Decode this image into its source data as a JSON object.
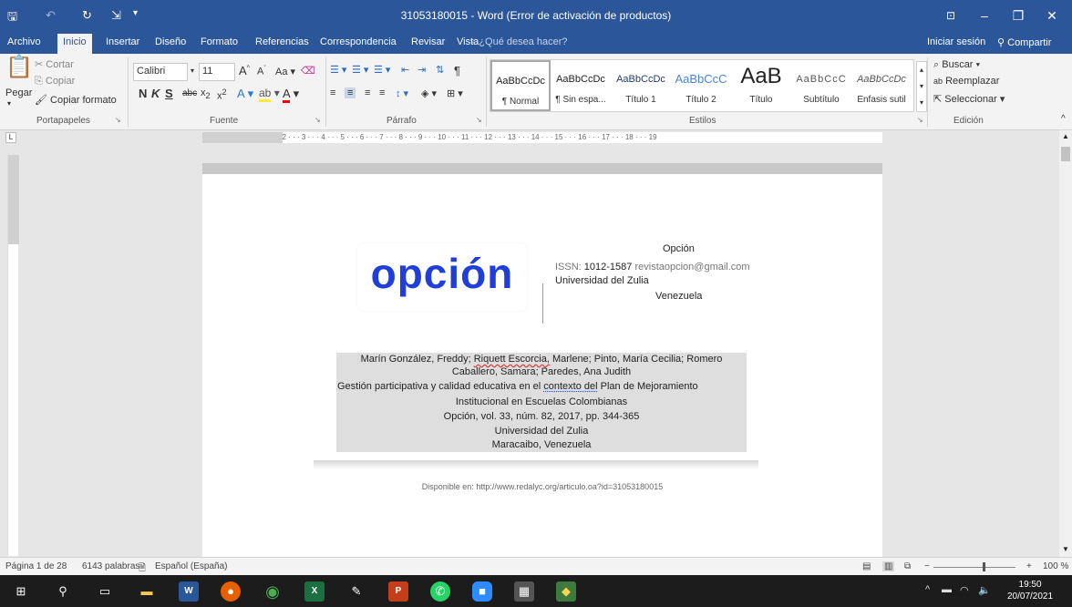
{
  "window": {
    "title": "31053180015 - Word (Error de activación de productos)"
  },
  "tabs": [
    "Archivo",
    "Inicio",
    "Insertar",
    "Diseño",
    "Formato",
    "Referencias",
    "Correspondencia",
    "Revisar",
    "Vista"
  ],
  "tell_me": "¿Qué desea hacer?",
  "account": {
    "signin": "Iniciar sesión",
    "share": "Compartir"
  },
  "ribbon": {
    "clipboard": {
      "paste": "Pegar",
      "cut": "Cortar",
      "copy": "Copiar",
      "format_painter": "Copiar formato",
      "label": "Portapapeles"
    },
    "font": {
      "name": "Calibri",
      "size": "11",
      "label": "Fuente"
    },
    "paragraph": {
      "label": "Párrafo"
    },
    "styles": {
      "label": "Estilos",
      "items": [
        {
          "sample": "AaBbCcDc",
          "name": "¶ Normal"
        },
        {
          "sample": "AaBbCcDc",
          "name": "¶ Sin espa..."
        },
        {
          "sample": "AaBbCcDc",
          "name": "Título 1"
        },
        {
          "sample": "AaBbCcC",
          "name": "Título 2"
        },
        {
          "sample": "AaB",
          "name": "Título"
        },
        {
          "sample": "AaBbCcC",
          "name": "Subtítulo"
        },
        {
          "sample": "AaBbCcDc",
          "name": "Énfasis sutil"
        }
      ]
    },
    "editing": {
      "find": "Buscar",
      "replace": "Reemplazar",
      "select": "Seleccionar",
      "label": "Edición"
    }
  },
  "ruler": {
    "marks": "· 2 · · · 1 · · ·  · · · 1 · · · 2 · · · 3 · · · 4 · · · 5 · · · 6 · · · 7 · · · 8 · · · 9 · · · 10 · · · 11 · · · 12 · · · 13 · · · 14 · · · 15 · · · 16 · · · 17 · · · 18 · · · 19"
  },
  "document": {
    "logo_text": "opción",
    "journal_name": "Opción",
    "issn_label": "ISSN:",
    "issn": "1012-1587",
    "email": "revistaopcion@gmail.com",
    "university": "Universidad del Zulia",
    "country": "Venezuela",
    "citation": {
      "authors_1a": "Marín González, Freddy;",
      "authors_1b": "Riquett Escorcia,",
      "authors_1c": "Marlene; Pinto, María Cecilia; Romero",
      "authors_2": "Caballero, Samara; Paredes, Ana Judith",
      "title_1a": "Gestión participativa y calidad educativa en el",
      "title_1b": "contexto  del",
      "title_1c": "Plan de Mejoramiento",
      "title_2": "Institucional en Escuelas Colombianas",
      "source": "Opción, vol. 33, núm. 82, 2017, pp. 344-365",
      "publisher": "Universidad del Zulia",
      "place": "Maracaibo, Venezuela"
    },
    "available": "Disponible en: http://www.redalyc.org/articulo.oa?id=31053180015"
  },
  "status": {
    "page": "Página 1 de 28",
    "words": "6143 palabras",
    "language": "Español (España)",
    "zoom": "100 %"
  },
  "taskbar": {
    "time": "19:50",
    "date": "20/07/2021"
  },
  "colors": {
    "word_blue": "#2b579a",
    "logo_blue": "#1f3fd8",
    "taskbar": "#1c1c1c"
  }
}
